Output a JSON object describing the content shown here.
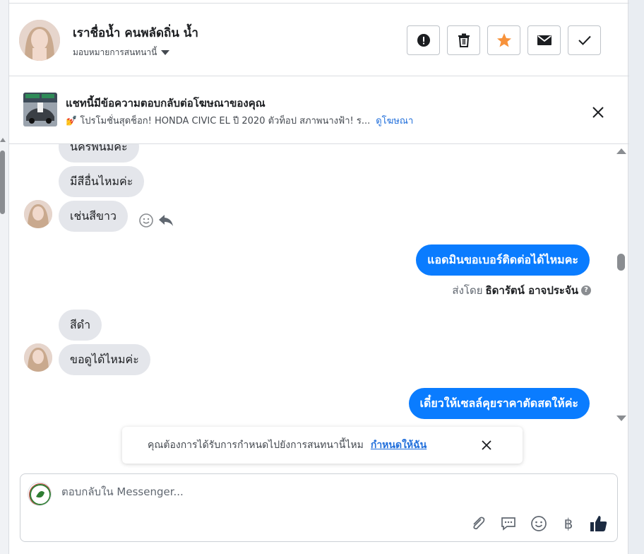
{
  "header": {
    "contact_name": "เราชื่อน้ำ คนพลัดถิ่น น้ำ",
    "assign_label": "มอบหมายการสนทนานี้",
    "actions": [
      "spam-report",
      "delete",
      "star",
      "mark-unread",
      "mark-done"
    ]
  },
  "ad_banner": {
    "title": "แชทนี้มีข้อความตอบกลับต่อโฆษณาของคุณ",
    "text": "💅 โปรโมชั่นสุดช็อก! HONDA CIVIC EL ปี 2020 ตัวท็อป สภาพนางฟ้า! ร...",
    "link": "ดูโฆษณา"
  },
  "messages": {
    "in_1": "นครพนมค่ะ",
    "in_2": "มีสีอื่นไหมค่ะ",
    "in_3": "เช่นสีขาว",
    "out_1": "แอดมินขอเบอร์ติดต่อได้ไหมคะ",
    "sent_by_label": "ส่งโดย",
    "sent_by_name": "ธิดารัตน์ อาจประจัน",
    "in_4": "สีดำ",
    "in_5": "ขอดูได้ไหมค่ะ",
    "out_2": "เดี๋ยวให้เซลล์คุยราคาตัดสดให้ค่ะ"
  },
  "toast": {
    "text": "คุณต้องการได้รับการกำหนดไปยังการสนทนานี้ไหม",
    "link": "กำหนดให้ฉัน"
  },
  "composer": {
    "placeholder": "ตอบกลับใน Messenger...",
    "tools": [
      "attachment-icon",
      "saved-reply-icon",
      "emoji-icon",
      "baht-icon",
      "like-icon"
    ]
  },
  "colors": {
    "accent": "#0a7cff",
    "star": "#f7923b",
    "link": "#216fdb"
  }
}
